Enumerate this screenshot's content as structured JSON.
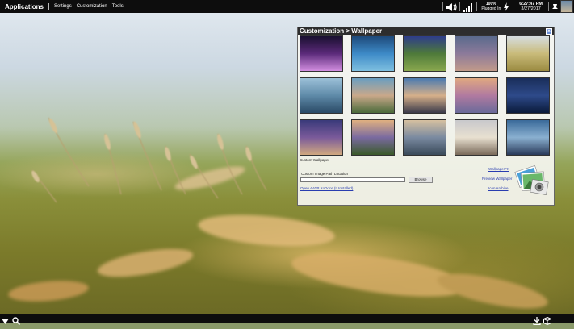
{
  "topbar": {
    "applications_label": "Applications",
    "menu": [
      "Settings",
      "Customization",
      "Tools"
    ],
    "battery": {
      "percent": "100%",
      "status": "Plugged In"
    },
    "clock": {
      "time": "6:27:47 PM",
      "date": "3/27/2017"
    }
  },
  "window": {
    "title": "Customization > Wallpaper",
    "close_label": "x",
    "thumbnails": [
      {
        "name": "thumb-nebula",
        "colors": [
          "#1a1030",
          "#5b2a7a",
          "#d28ee0"
        ]
      },
      {
        "name": "thumb-blue-stones",
        "colors": [
          "#1e4a7a",
          "#3d8ac7",
          "#7fc0e0"
        ]
      },
      {
        "name": "thumb-blueberries",
        "colors": [
          "#2e3d8a",
          "#4e7a3a",
          "#8aa84e"
        ]
      },
      {
        "name": "thumb-city-skyline",
        "colors": [
          "#5a6a8c",
          "#8c7a9a",
          "#c29a8a"
        ]
      },
      {
        "name": "thumb-wheat-field",
        "colors": [
          "#d6dde0",
          "#c9bb7a",
          "#9a8a40"
        ]
      },
      {
        "name": "thumb-lake-pier",
        "colors": [
          "#9cc0d8",
          "#5e8aa8",
          "#2a4a66"
        ]
      },
      {
        "name": "thumb-palm-beach",
        "colors": [
          "#6a9ec0",
          "#c9a88a",
          "#4a6a3a"
        ]
      },
      {
        "name": "thumb-coast-sunset",
        "colors": [
          "#4a7ab0",
          "#d6b08a",
          "#3a3a4a"
        ]
      },
      {
        "name": "thumb-mountain-dusk",
        "colors": [
          "#e0a880",
          "#b07aa0",
          "#6a6a9a"
        ]
      },
      {
        "name": "thumb-blue-hills",
        "colors": [
          "#1a2e5a",
          "#2e4a8a",
          "#0a1a3a"
        ]
      },
      {
        "name": "thumb-wind-turbine",
        "colors": [
          "#3a3a7a",
          "#7a5a9a",
          "#d0a880"
        ]
      },
      {
        "name": "thumb-sunset-field",
        "colors": [
          "#e0b080",
          "#7a6aa0",
          "#3a5a2a"
        ]
      },
      {
        "name": "thumb-mountain-valley",
        "colors": [
          "#d6c0a0",
          "#7a8aa0",
          "#3a4a5a"
        ]
      },
      {
        "name": "thumb-puppy",
        "colors": [
          "#c8c8cc",
          "#e8e0d0",
          "#7a6a5a"
        ]
      },
      {
        "name": "thumb-coastal-city",
        "colors": [
          "#3a6a9a",
          "#8ab0d0",
          "#2a3a5a"
        ]
      }
    ],
    "custom_wallpaper_label": "Custom Wallpaper",
    "custom_path_label": "Custom Image Path Location",
    "path_value": "",
    "browse_label": "Browse",
    "open_aatp_link": "Open AATP XoDoce (If Installed)",
    "wallpaperfx_link": "WallpaperFX",
    "preview_link": "Preview Wallpaper",
    "icon_archive_link": "Icon Archive"
  }
}
